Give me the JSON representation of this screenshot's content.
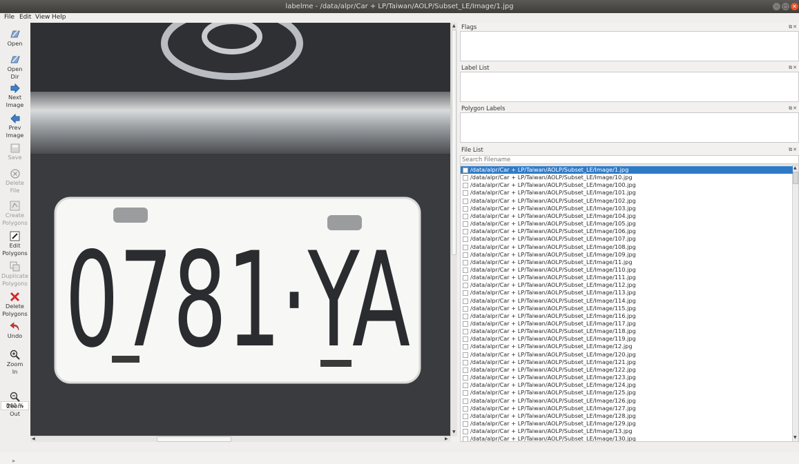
{
  "window": {
    "title": "labelme - /data/alpr/Car + LP/Taiwan/AOLP/Subset_LE/Image/1.jpg"
  },
  "menu": {
    "file": "File",
    "edit": "Edit",
    "view": "View",
    "help": "Help"
  },
  "toolbar": {
    "open": "Open",
    "open_dir_1": "Open",
    "open_dir_2": "Dir",
    "next_1": "Next",
    "next_2": "Image",
    "prev_1": "Prev",
    "prev_2": "Image",
    "save": "Save",
    "delete_file_1": "Delete",
    "delete_file_2": "File",
    "create_1": "Create",
    "create_2": "Polygons",
    "edit_1": "Edit",
    "edit_2": "Polygons",
    "duplicate_1": "Duplicate",
    "duplicate_2": "Polygons",
    "delete_poly_1": "Delete",
    "delete_poly_2": "Polygons",
    "undo": "Undo",
    "zoom_in_1": "Zoom",
    "zoom_in_2": "In",
    "zoom_value": "840 %",
    "zoom_out_1": "Zoom",
    "zoom_out_2": "Out",
    "more": "»"
  },
  "image": {
    "plate_text": "0781·YA"
  },
  "docks": {
    "flags": "Flags",
    "label_list": "Label List",
    "polygon_labels": "Polygon Labels",
    "file_list": "File List",
    "dock_buttons": "⧉✕"
  },
  "search": {
    "placeholder": "Search Filename"
  },
  "files": [
    "/data/alpr/Car + LP/Taiwan/AOLP/Subset_LE/Image/1.jpg",
    "/data/alpr/Car + LP/Taiwan/AOLP/Subset_LE/Image/10.jpg",
    "/data/alpr/Car + LP/Taiwan/AOLP/Subset_LE/Image/100.jpg",
    "/data/alpr/Car + LP/Taiwan/AOLP/Subset_LE/Image/101.jpg",
    "/data/alpr/Car + LP/Taiwan/AOLP/Subset_LE/Image/102.jpg",
    "/data/alpr/Car + LP/Taiwan/AOLP/Subset_LE/Image/103.jpg",
    "/data/alpr/Car + LP/Taiwan/AOLP/Subset_LE/Image/104.jpg",
    "/data/alpr/Car + LP/Taiwan/AOLP/Subset_LE/Image/105.jpg",
    "/data/alpr/Car + LP/Taiwan/AOLP/Subset_LE/Image/106.jpg",
    "/data/alpr/Car + LP/Taiwan/AOLP/Subset_LE/Image/107.jpg",
    "/data/alpr/Car + LP/Taiwan/AOLP/Subset_LE/Image/108.jpg",
    "/data/alpr/Car + LP/Taiwan/AOLP/Subset_LE/Image/109.jpg",
    "/data/alpr/Car + LP/Taiwan/AOLP/Subset_LE/Image/11.jpg",
    "/data/alpr/Car + LP/Taiwan/AOLP/Subset_LE/Image/110.jpg",
    "/data/alpr/Car + LP/Taiwan/AOLP/Subset_LE/Image/111.jpg",
    "/data/alpr/Car + LP/Taiwan/AOLP/Subset_LE/Image/112.jpg",
    "/data/alpr/Car + LP/Taiwan/AOLP/Subset_LE/Image/113.jpg",
    "/data/alpr/Car + LP/Taiwan/AOLP/Subset_LE/Image/114.jpg",
    "/data/alpr/Car + LP/Taiwan/AOLP/Subset_LE/Image/115.jpg",
    "/data/alpr/Car + LP/Taiwan/AOLP/Subset_LE/Image/116.jpg",
    "/data/alpr/Car + LP/Taiwan/AOLP/Subset_LE/Image/117.jpg",
    "/data/alpr/Car + LP/Taiwan/AOLP/Subset_LE/Image/118.jpg",
    "/data/alpr/Car + LP/Taiwan/AOLP/Subset_LE/Image/119.jpg",
    "/data/alpr/Car + LP/Taiwan/AOLP/Subset_LE/Image/12.jpg",
    "/data/alpr/Car + LP/Taiwan/AOLP/Subset_LE/Image/120.jpg",
    "/data/alpr/Car + LP/Taiwan/AOLP/Subset_LE/Image/121.jpg",
    "/data/alpr/Car + LP/Taiwan/AOLP/Subset_LE/Image/122.jpg",
    "/data/alpr/Car + LP/Taiwan/AOLP/Subset_LE/Image/123.jpg",
    "/data/alpr/Car + LP/Taiwan/AOLP/Subset_LE/Image/124.jpg",
    "/data/alpr/Car + LP/Taiwan/AOLP/Subset_LE/Image/125.jpg",
    "/data/alpr/Car + LP/Taiwan/AOLP/Subset_LE/Image/126.jpg",
    "/data/alpr/Car + LP/Taiwan/AOLP/Subset_LE/Image/127.jpg",
    "/data/alpr/Car + LP/Taiwan/AOLP/Subset_LE/Image/128.jpg",
    "/data/alpr/Car + LP/Taiwan/AOLP/Subset_LE/Image/129.jpg",
    "/data/alpr/Car + LP/Taiwan/AOLP/Subset_LE/Image/13.jpg",
    "/data/alpr/Car + LP/Taiwan/AOLP/Subset_LE/Image/130.jpg"
  ],
  "colors": {
    "selection": "#2f7ac7",
    "delete_red": "#d42a2a",
    "nav_blue": "#3f7fc8"
  }
}
